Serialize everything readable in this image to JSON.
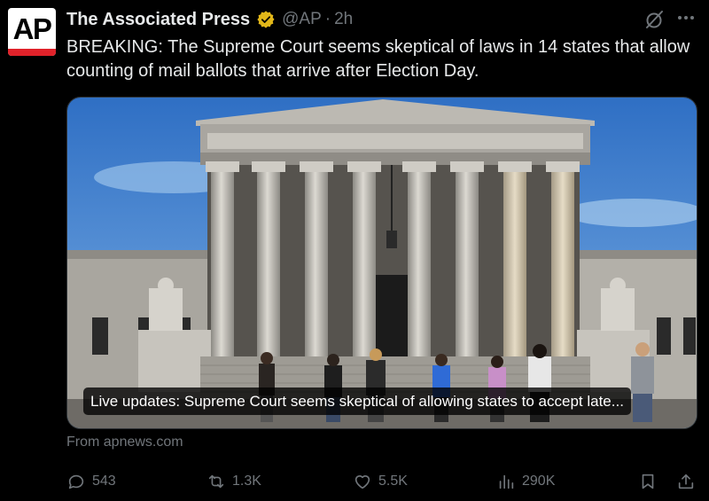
{
  "author": {
    "avatar_text": "AP",
    "name": "The Associated Press",
    "handle": "@AP",
    "separator": "·",
    "time": "2h",
    "verified_badge": "gold-verified-icon"
  },
  "tweet": {
    "text": "BREAKING: The Supreme Court seems skeptical of laws in 14 states that allow counting of mail ballots that arrive after Election Day."
  },
  "card": {
    "image": "supreme-court-building-photo",
    "caption": "Live updates: Supreme Court seems skeptical of allowing states to accept late...",
    "source": "From apnews.com"
  },
  "actions": {
    "replies": "543",
    "reposts": "1.3K",
    "likes": "5.5K",
    "views": "290K"
  },
  "colors": {
    "background": "#000000",
    "text": "#e7e9ea",
    "muted": "#71767b",
    "verified_gold": "#e2b719",
    "ap_red": "#e0222a"
  }
}
